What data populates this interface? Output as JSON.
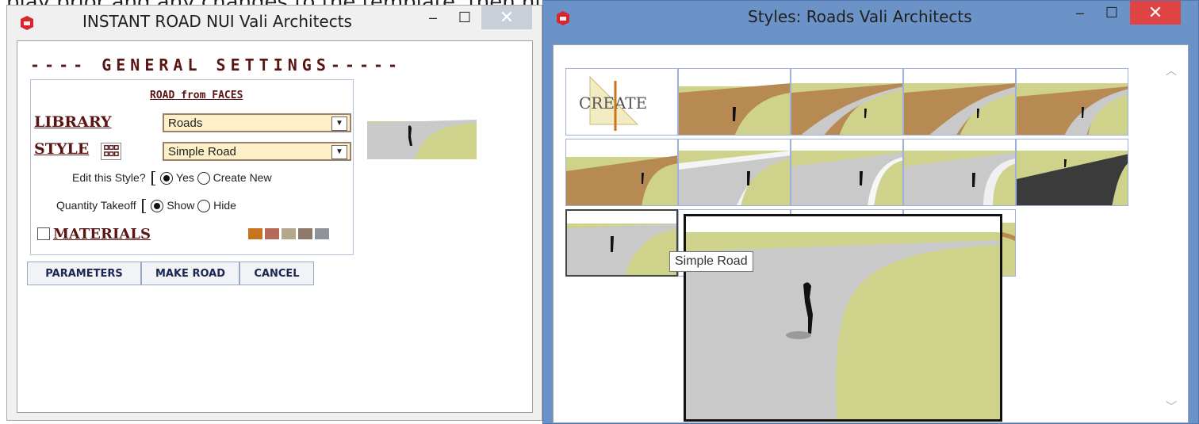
{
  "background_partial_text": "play prior and any changes to the template, then hit",
  "left_window": {
    "title": "INSTANT ROAD NUI  Vali Architects",
    "controls": {
      "minimize": "–",
      "maximize": "☐",
      "close": "✕"
    },
    "general_settings": "---- GENERAL  SETTINGS-----",
    "road_from_faces": "ROAD from FACES",
    "library_label": "LIBRARY",
    "library_value": "Roads",
    "style_label": "STYLE",
    "style_value": "Simple Road",
    "edit_style_label": "Edit this Style?",
    "edit_yes": "Yes",
    "edit_create_new": "Create New",
    "quantity_label": "Quantity Takeoff",
    "quantity_show": "Show",
    "quantity_hide": "Hide",
    "materials_label": "MATERIALS",
    "buttons": {
      "parameters": "PARAMETERS",
      "make_road": "MAKE ROAD",
      "cancel": "CANCEL"
    }
  },
  "right_window": {
    "title": "Styles: Roads   Vali Architects",
    "controls": {
      "minimize": "–",
      "maximize": "☐",
      "close": "✕"
    },
    "create_tile": "CREATE",
    "tooltip": "Simple Road"
  },
  "colors": {
    "accent_red": "#5b1414",
    "grass": "#cfd28a",
    "road": "#c9c9c9",
    "dirt": "#b68a52",
    "asphalt": "#3b3b3b",
    "title_blue": "#6b93c7",
    "close_red": "#e04343"
  }
}
